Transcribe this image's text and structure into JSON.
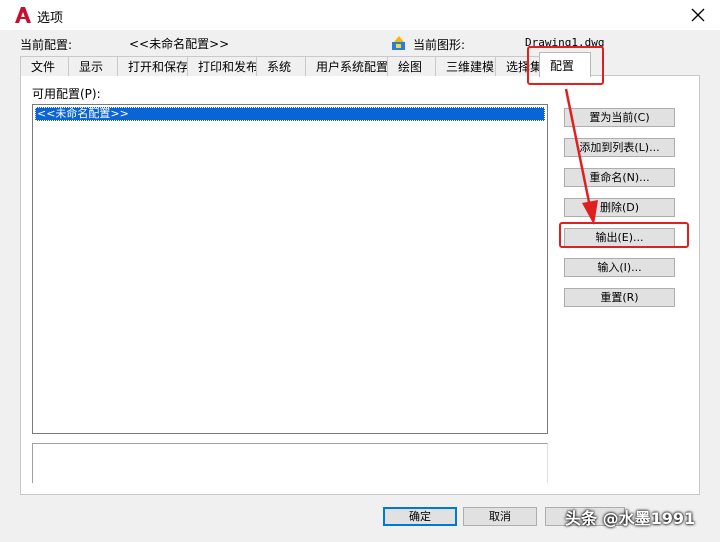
{
  "window": {
    "title": "选项"
  },
  "profile_row": {
    "current_profile_label": "当前配置:",
    "current_profile_value": "<<未命名配置>>",
    "current_drawing_label": "当前图形:",
    "current_drawing_value": "Drawing1.dwg"
  },
  "tabs": [
    {
      "label": "文件"
    },
    {
      "label": "显示"
    },
    {
      "label": "打开和保存"
    },
    {
      "label": "打印和发布"
    },
    {
      "label": "系统"
    },
    {
      "label": "用户系统配置"
    },
    {
      "label": "绘图"
    },
    {
      "label": "三维建模"
    },
    {
      "label": "选择集"
    },
    {
      "label": "配置"
    }
  ],
  "available_profiles_label": "可用配置(P):",
  "profiles": [
    "<<未命名配置>>"
  ],
  "buttons": {
    "set_current": "置为当前(C)",
    "add_to_list": "添加到列表(L)...",
    "rename": "重命名(N)...",
    "delete": "删除(D)",
    "export": "输出(E)...",
    "import": "输入(I)...",
    "reset": "重置(R)"
  },
  "footer": {
    "ok": "确定",
    "cancel": "取消"
  },
  "watermark": "头条 @水墨1991",
  "colors": {
    "annotation": "#e02020",
    "selection": "#0a64d6",
    "app_icon": "#c8102e"
  }
}
